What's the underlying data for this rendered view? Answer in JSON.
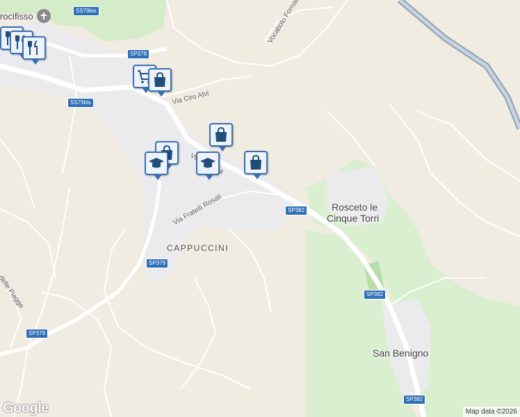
{
  "places": {
    "rosceto_line1": "Rosceto le",
    "rosceto_line2": "Cinque Torri",
    "san_benigno": "San Benigno",
    "cappuccini": "CAPPUCCINI",
    "crocifisso": "rocifisso"
  },
  "streets": {
    "vocabolo_fornaci": "Vocabolo Fornaci in Croc",
    "via_ciro_alvi": "Via Ciro Alvi",
    "via_flaminia": "Via Tiberina",
    "via_fratelli_rosati": "Via Fratelli Rosati",
    "delle_piagge": "delle Piagge"
  },
  "road_shields": {
    "ss79bis_top": "SS79bis",
    "sp378": "SP378",
    "ss79bis_mid": "SS79bis",
    "sp382_a": "SP382",
    "sp382_b": "SP382",
    "sp382_c": "SP382",
    "sp379_a": "SP379",
    "sp379_b": "SP379"
  },
  "poi_icons": [
    "shopping-bag-icon",
    "shopping-cart-icon",
    "graduation-cap-icon",
    "restaurant-icon",
    "church-icon"
  ],
  "colors": {
    "land": "#f1ece2",
    "park": "#d8eecf",
    "road": "#ffffff",
    "highway": "#8fa3b8",
    "urban": "#e8e8ec",
    "marker_border": "#3a6fb0",
    "marker_icon": "#1f4e79"
  },
  "footer": {
    "logo": "Google",
    "attribution": "Map data ©2026"
  }
}
